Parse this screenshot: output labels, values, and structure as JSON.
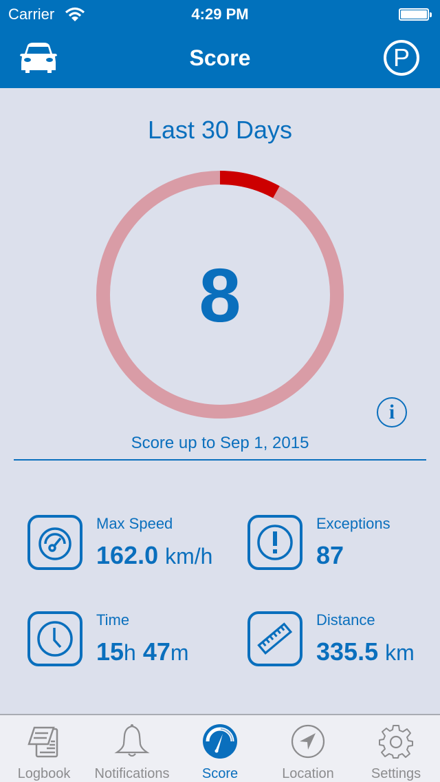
{
  "status_bar": {
    "carrier": "Carrier",
    "time": "4:29 PM",
    "battery_level": 1.0
  },
  "nav": {
    "title": "Score",
    "left_icon": "car-icon",
    "right_icon": "parking-icon",
    "right_glyph": "P"
  },
  "score": {
    "period_title": "Last 30 Days",
    "value": "8",
    "value_numeric": 8,
    "max": 100,
    "date_label": "Score up to Sep 1, 2015",
    "info_glyph": "i",
    "colors": {
      "track": "#d99ca6",
      "progress": "#cc0000",
      "text": "#0a6fbd"
    }
  },
  "stats": [
    {
      "label": "Max Speed",
      "icon": "speedometer-icon",
      "value": "162.0",
      "unit": "km/h"
    },
    {
      "label": "Exceptions",
      "icon": "exclamation-icon",
      "value": "87",
      "unit": ""
    },
    {
      "label": "Time",
      "icon": "clock-icon",
      "hours": "15",
      "hours_unit": "h",
      "minutes": "47",
      "minutes_unit": "m"
    },
    {
      "label": "Distance",
      "icon": "ruler-icon",
      "value": "335.5",
      "unit": "km"
    }
  ],
  "tabs": [
    {
      "label": "Logbook",
      "icon": "logbook-icon",
      "active": false
    },
    {
      "label": "Notifications",
      "icon": "bell-icon",
      "active": false
    },
    {
      "label": "Score",
      "icon": "score-gauge-icon",
      "active": true
    },
    {
      "label": "Location",
      "icon": "location-arrow-icon",
      "active": false
    },
    {
      "label": "Settings",
      "icon": "gear-icon",
      "active": false
    }
  ],
  "colors": {
    "brand": "#0171bc",
    "accent_text": "#0a6fbd",
    "background": "#dce0ec",
    "tab_inactive": "#8c8c8e"
  }
}
